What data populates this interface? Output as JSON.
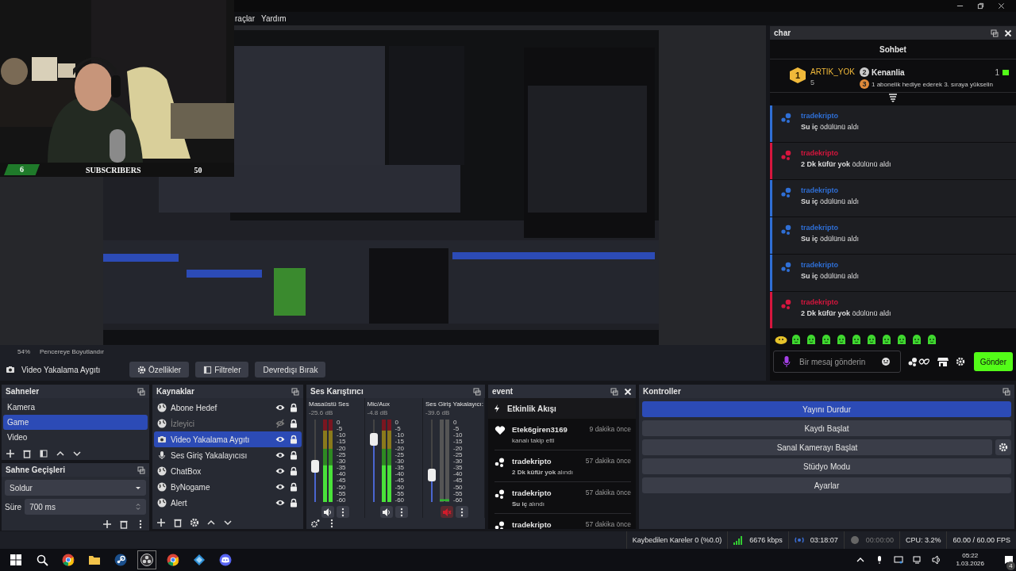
{
  "menu": [
    "raçlar",
    "Yardım"
  ],
  "overlay": {
    "count": "6",
    "label": "SUBSCRIBERS",
    "goal": "50"
  },
  "preview": {
    "zoom": "54%",
    "fit_label": "Pencereye Boyutlandır"
  },
  "source_toolbar": {
    "source": "Video Yakalama Aygıtı",
    "buttons": [
      {
        "kind": "properties",
        "label": "Özellikler"
      },
      {
        "kind": "filters",
        "label": "Filtreler"
      },
      {
        "kind": "plain",
        "label": "Devredışı Bırak"
      }
    ]
  },
  "scenes": {
    "title": "Sahneler",
    "items": [
      {
        "name": "Kamera",
        "selected": false
      },
      {
        "name": "Game",
        "selected": true
      },
      {
        "name": "Video",
        "selected": false
      }
    ]
  },
  "transitions": {
    "title": "Sahne Geçişleri",
    "type": "Soldur",
    "duration_label": "Süre",
    "duration": "700 ms"
  },
  "sources": {
    "title": "Kaynaklar",
    "items": [
      {
        "kind": "browser",
        "name": "Abone Hedef",
        "visible": true,
        "locked": true,
        "selected": false
      },
      {
        "kind": "browser",
        "name": "İzleyici",
        "visible": false,
        "locked": true,
        "selected": false
      },
      {
        "kind": "camera",
        "name": "Video Yakalama Aygıtı",
        "visible": true,
        "locked": true,
        "selected": true
      },
      {
        "kind": "mic",
        "name": "Ses Giriş Yakalayıcısı",
        "visible": true,
        "locked": true,
        "selected": false
      },
      {
        "kind": "browser",
        "name": "ChatBox",
        "visible": true,
        "locked": true,
        "selected": false
      },
      {
        "kind": "browser",
        "name": "ByNogame",
        "visible": true,
        "locked": true,
        "selected": false
      },
      {
        "kind": "browser",
        "name": "Alert",
        "visible": true,
        "locked": true,
        "selected": false
      }
    ]
  },
  "mixer": {
    "title": "Ses Karıştırıcı",
    "channels": [
      {
        "name": "Masaüstü Ses",
        "reading": "-25.6 dB",
        "level": 0.43,
        "muted": false,
        "scale": [
          "0",
          "-5",
          "-10",
          "-15",
          "-20",
          "-25",
          "-30",
          "-35",
          "-40",
          "-45",
          "-50",
          "-55",
          "-60"
        ]
      },
      {
        "name": "Mic/Aux",
        "reading": "-4.8 dB",
        "level": 0.76,
        "muted": false,
        "scale": [
          "0",
          "-5",
          "-10",
          "-15",
          "-20",
          "-25",
          "-30",
          "-35",
          "-40",
          "-45",
          "-50",
          "-55",
          "-60"
        ]
      },
      {
        "name": "Ses Giriş Yakalayıcı:",
        "reading": "-39.6 dB",
        "level": 0.33,
        "muted": true,
        "scale": [
          "0",
          "-5",
          "-10",
          "-15",
          "-20",
          "-25",
          "-30",
          "-35",
          "-40",
          "-45",
          "-50",
          "-55",
          "-60"
        ]
      }
    ]
  },
  "events": {
    "title": "event",
    "heading": "Etkinlik Akışı",
    "items": [
      {
        "kind": "follow",
        "user": "Etek6giren3169",
        "time": "9 dakika önce",
        "text": "kanalı takip etti"
      },
      {
        "kind": "reward",
        "user": "tradekripto",
        "time": "57 dakika önce",
        "text": "**2 Dk küfür yok** alındı"
      },
      {
        "kind": "reward",
        "user": "tradekripto",
        "time": "57 dakika önce",
        "text": "**Su iç** alındı"
      },
      {
        "kind": "reward",
        "user": "tradekripto",
        "time": "57 dakika önce"
      }
    ]
  },
  "controls": {
    "title": "Kontroller",
    "buttons": [
      {
        "label": "Yayını Durdur",
        "active": true,
        "settings": false
      },
      {
        "label": "Kaydı Başlat",
        "active": false,
        "settings": false
      },
      {
        "label": "Sanal Kamerayı Başlat",
        "active": false,
        "settings": true
      },
      {
        "label": "Stüdyo Modu",
        "active": false,
        "settings": false
      },
      {
        "label": "Ayarlar",
        "active": false,
        "settings": false
      }
    ]
  },
  "chat": {
    "title": "char",
    "heading": "Sohbet",
    "leader": {
      "rank": "1",
      "user": "ARTIK_YOK",
      "user_count": "5",
      "gifter_rank": "2",
      "gifter": "Kenanlia",
      "gifter_count": "1",
      "hint_rank": "3",
      "hint": "1 abonelik hediye ederek 3. sıraya yükselin"
    },
    "messages": [
      {
        "user": "tradekripto",
        "text": "**Su iç** ödülünü aldı",
        "color": "#2f6fd6"
      },
      {
        "user": "tradekripto",
        "text": "**2 Dk küfür yok** ödülünü aldı",
        "color": "#d6163e"
      },
      {
        "user": "tradekripto",
        "text": "**Su iç** ödülünü aldı",
        "color": "#2f6fd6"
      },
      {
        "user": "tradekripto",
        "text": "**Su iç** ödülünü aldı",
        "color": "#2f6fd6"
      },
      {
        "user": "tradekripto",
        "text": "**Su iç** ödülünü aldı",
        "color": "#2f6fd6"
      },
      {
        "user": "tradekripto",
        "text": "**2 Dk küfür yok** ödülünü aldı",
        "color": "#d6163e"
      }
    ],
    "placeholder": "Bir mesaj gönderin",
    "send": "Gönder"
  },
  "status": {
    "dropped": "Kaybedilen Kareler 0 (%0.0)",
    "bitrate": "6676 kbps",
    "stream_time": "03:18:07",
    "record_time": "00:00:00",
    "cpu": "CPU: 3.2%",
    "fps": "60.00 / 60.00 FPS"
  },
  "taskbar": {
    "apps": [
      {
        "kind": "chrome"
      },
      {
        "kind": "folder"
      },
      {
        "kind": "steam"
      },
      {
        "kind": "obs"
      },
      {
        "kind": "chrome"
      },
      {
        "kind": "app"
      },
      {
        "kind": "discord"
      }
    ],
    "time": "05:22",
    "date": "1.03.2026",
    "notifications": "4"
  }
}
